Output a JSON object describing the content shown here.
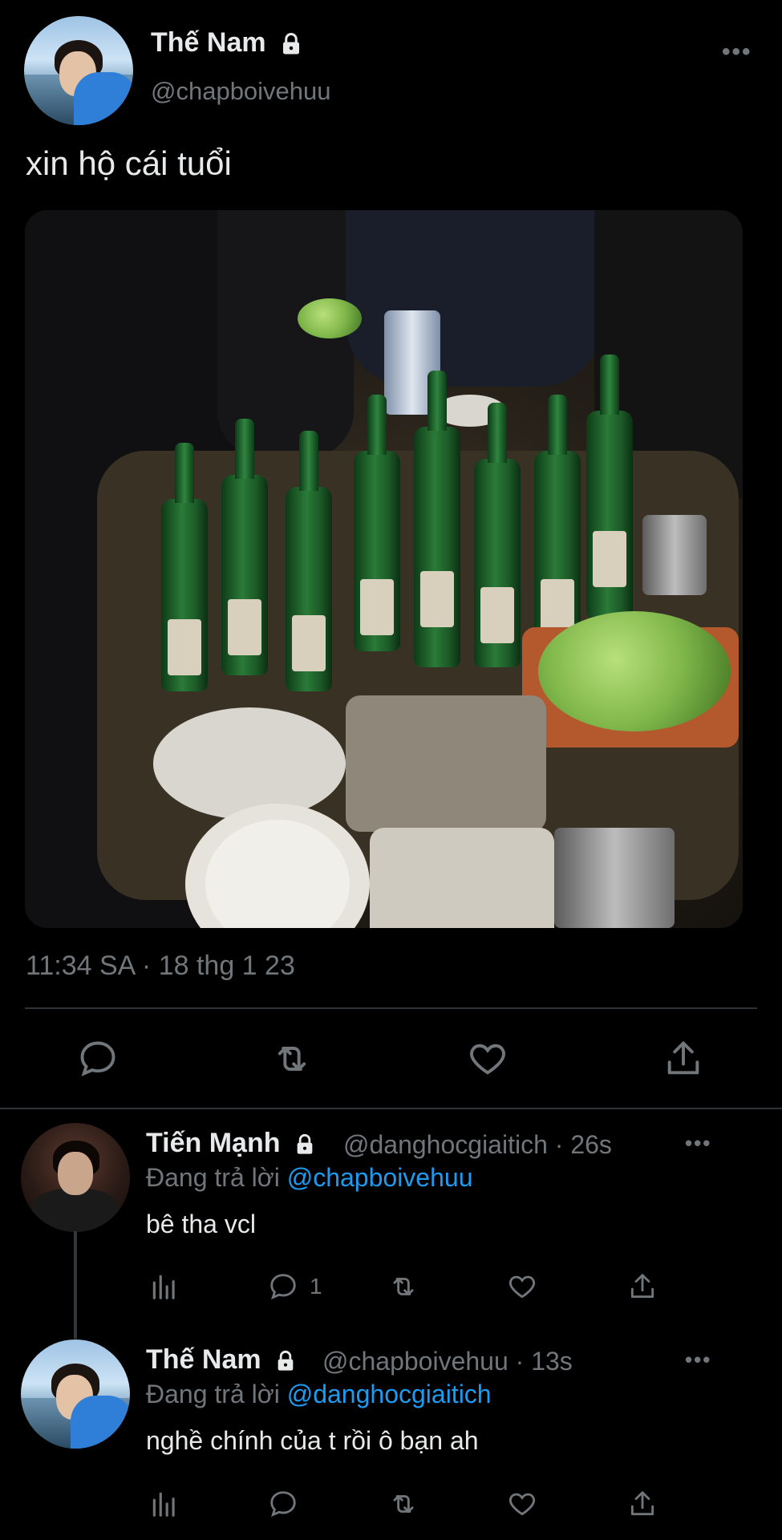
{
  "main_tweet": {
    "display_name": "Thế Nam",
    "handle": "@chapboivehuu",
    "text": "xin hộ cái tuổi",
    "timestamp": "11:34 SA · 18 thg 1 23",
    "more": "•••",
    "photo_icon": "photo-of-table-with-bottles",
    "lock_icon": "lock-icon",
    "actions": [
      "reply-icon",
      "retweet-icon",
      "like-icon",
      "share-icon"
    ]
  },
  "replies": [
    {
      "display_name": "Tiến Mạnh",
      "meta": "@danghocgiaitich · 26s",
      "replying_prefix": "Đang trả lời",
      "replying_to": "@chapboivehuu",
      "text": "bê tha vcl",
      "more": "•••",
      "reply_count": "1",
      "actions": [
        "views-icon",
        "reply-icon",
        "retweet-icon",
        "like-icon",
        "share-icon"
      ]
    },
    {
      "display_name": "Thế Nam",
      "meta": "@chapboivehuu · 13s",
      "replying_prefix": "Đang trả lời",
      "replying_to": "@danghocgiaitich",
      "text": "nghề chính của t rồi ô bạn ah",
      "more": "•••",
      "actions": [
        "views-icon",
        "reply-icon",
        "retweet-icon",
        "like-icon",
        "share-icon"
      ]
    }
  ],
  "colors": {
    "background": "#000000",
    "text": "#e7e9ea",
    "muted": "#71767b",
    "link": "#1d9bf0",
    "divider": "#2f3336"
  }
}
